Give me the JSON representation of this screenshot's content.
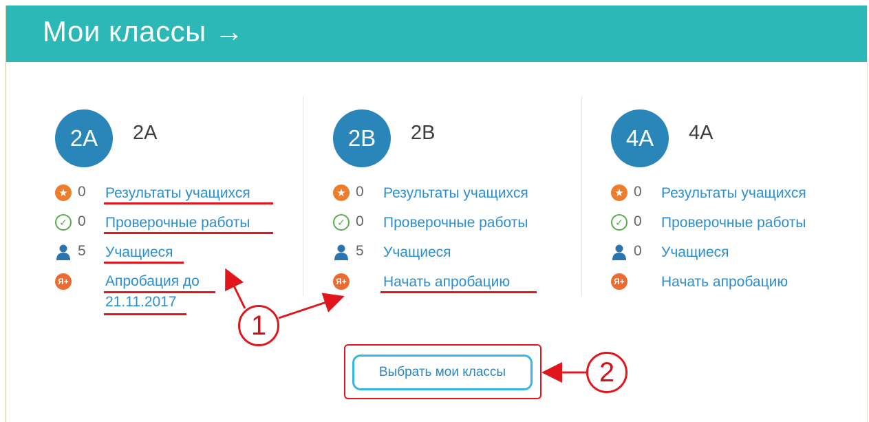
{
  "header": {
    "title": "Мои классы →"
  },
  "classes": [
    {
      "badge": "2A",
      "name": "2A",
      "results_count": "0",
      "results_label": "Результаты учащихся",
      "tests_count": "0",
      "tests_label": "Проверочные работы",
      "students_count": "5",
      "students_label": "Учащиеся",
      "approbation_label": "Апробация до 21.11.2017"
    },
    {
      "badge": "2B",
      "name": "2B",
      "results_count": "0",
      "results_label": "Результаты учащихся",
      "tests_count": "0",
      "tests_label": "Проверочные работы",
      "students_count": "5",
      "students_label": "Учащиеся",
      "approbation_label": "Начать апробацию"
    },
    {
      "badge": "4A",
      "name": "4A",
      "results_count": "0",
      "results_label": "Результаты учащихся",
      "tests_count": "0",
      "tests_label": "Проверочные работы",
      "students_count": "0",
      "students_label": "Учащиеся",
      "approbation_label": "Начать апробацию"
    }
  ],
  "select_button": {
    "label": "Выбрать мои классы"
  },
  "callouts": {
    "one": "1",
    "two": "2"
  },
  "icons": {
    "results": "star-icon",
    "tests": "check-circle-icon",
    "students": "user-icon",
    "approbation": "yandex-plus-icon"
  },
  "colors": {
    "header": "#2cb8b6",
    "badge": "#2a86b9",
    "link": "#2a8fd0",
    "annotation": "#e0161c"
  }
}
